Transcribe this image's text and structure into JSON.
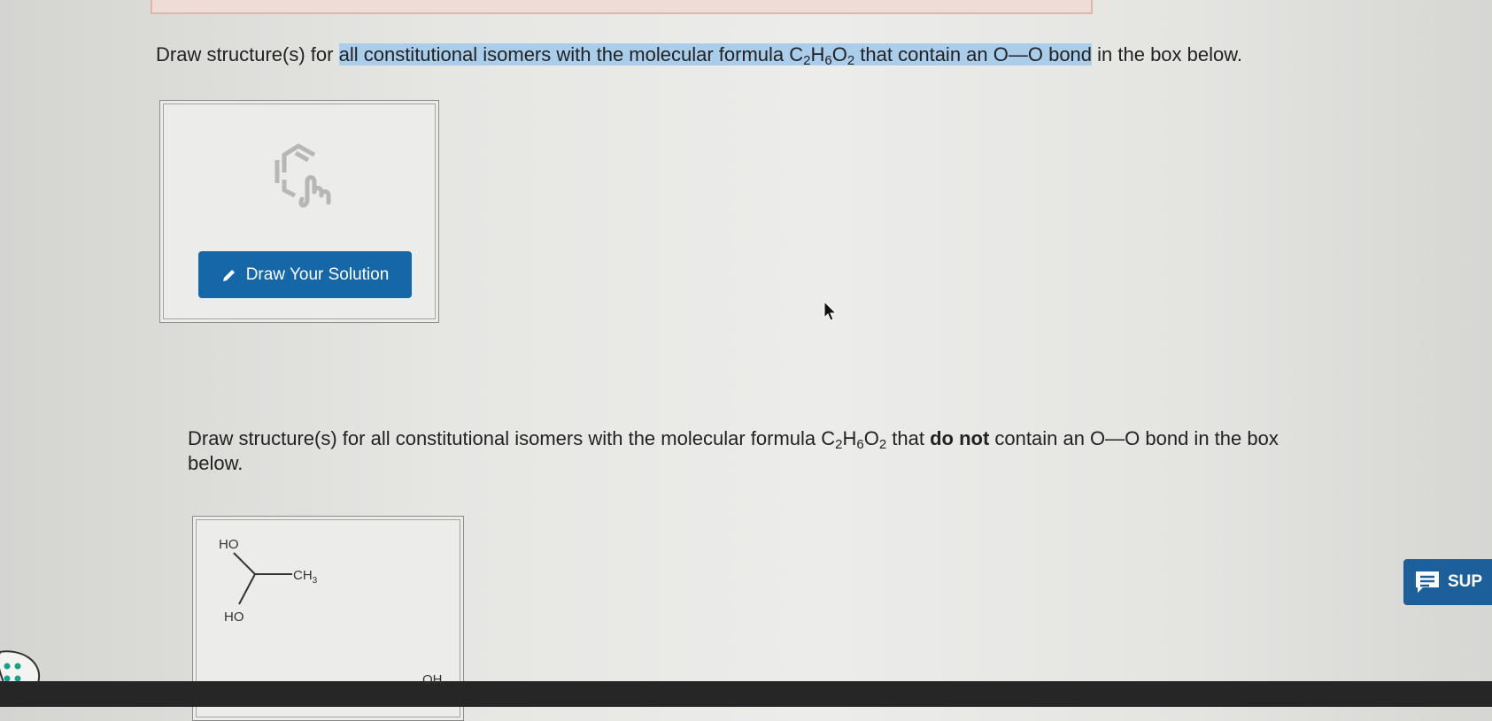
{
  "question1": {
    "text_before": "Draw structure(s) for ",
    "highlight_a": "all constitutional isomers with the molecular formula C",
    "sub_c": "2",
    "h": "H",
    "sub_h": "6",
    "o": "O",
    "sub_o": "2",
    "highlight_b": " that contain an O—O bond",
    "text_after": " in the box below."
  },
  "draw_button": {
    "label": "Draw Your Solution",
    "icon": "pencil-icon"
  },
  "question2": {
    "text_before": "Draw structure(s) for all constitutional isomers with the molecular formula C",
    "sub_c": "2",
    "h": "H",
    "sub_h": "6",
    "o": "O",
    "sub_o": "2",
    "text_mid": " that ",
    "bold": "do not",
    "text_after": " contain an O—O bond in the box below."
  },
  "molecule": {
    "label_ho_top": "HO",
    "label_ho_bottom": "HO",
    "label_ch": "CH",
    "label_ch_sub": "3",
    "label_oh": "OH"
  },
  "support_button": {
    "label": "SUP",
    "icon": "chat-icon"
  },
  "colors": {
    "button_blue": "#1667a8",
    "highlight": "#aacdec",
    "support_blue": "#1d5f99"
  }
}
